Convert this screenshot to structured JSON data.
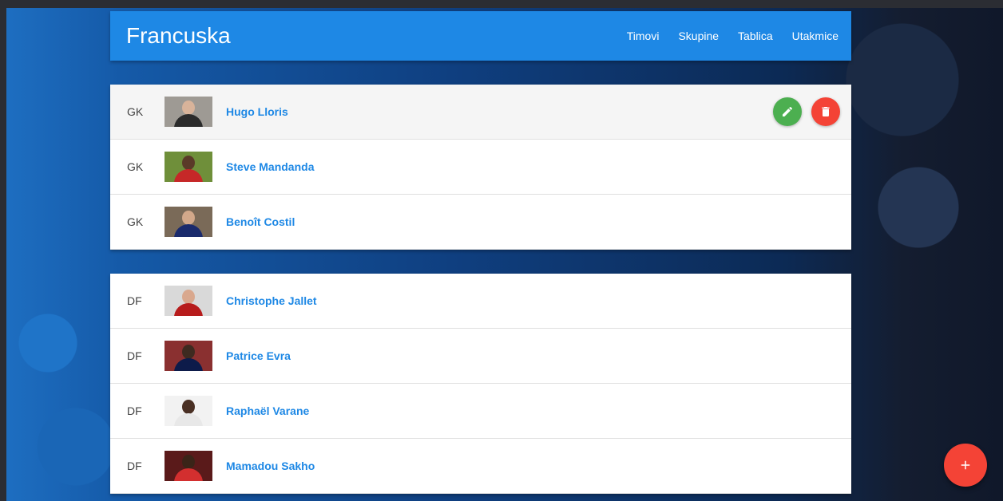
{
  "header": {
    "title": "Francuska",
    "nav": [
      {
        "label": "Timovi"
      },
      {
        "label": "Skupine"
      },
      {
        "label": "Tablica"
      },
      {
        "label": "Utakmice"
      }
    ]
  },
  "groups": [
    {
      "players": [
        {
          "position": "GK",
          "name": "Hugo Lloris"
        },
        {
          "position": "GK",
          "name": "Steve Mandanda"
        },
        {
          "position": "GK",
          "name": "Benoît Costil"
        }
      ]
    },
    {
      "players": [
        {
          "position": "DF",
          "name": "Christophe Jallet"
        },
        {
          "position": "DF",
          "name": "Patrice Evra"
        },
        {
          "position": "DF",
          "name": "Raphaël Varane"
        },
        {
          "position": "DF",
          "name": "Mamadou Sakho"
        }
      ]
    }
  ],
  "actions": {
    "edit_icon": "pencil-icon",
    "delete_icon": "trash-icon",
    "add_icon": "plus-icon"
  },
  "colors": {
    "primary": "#1e88e5",
    "edit": "#4caf50",
    "delete": "#f44336"
  }
}
